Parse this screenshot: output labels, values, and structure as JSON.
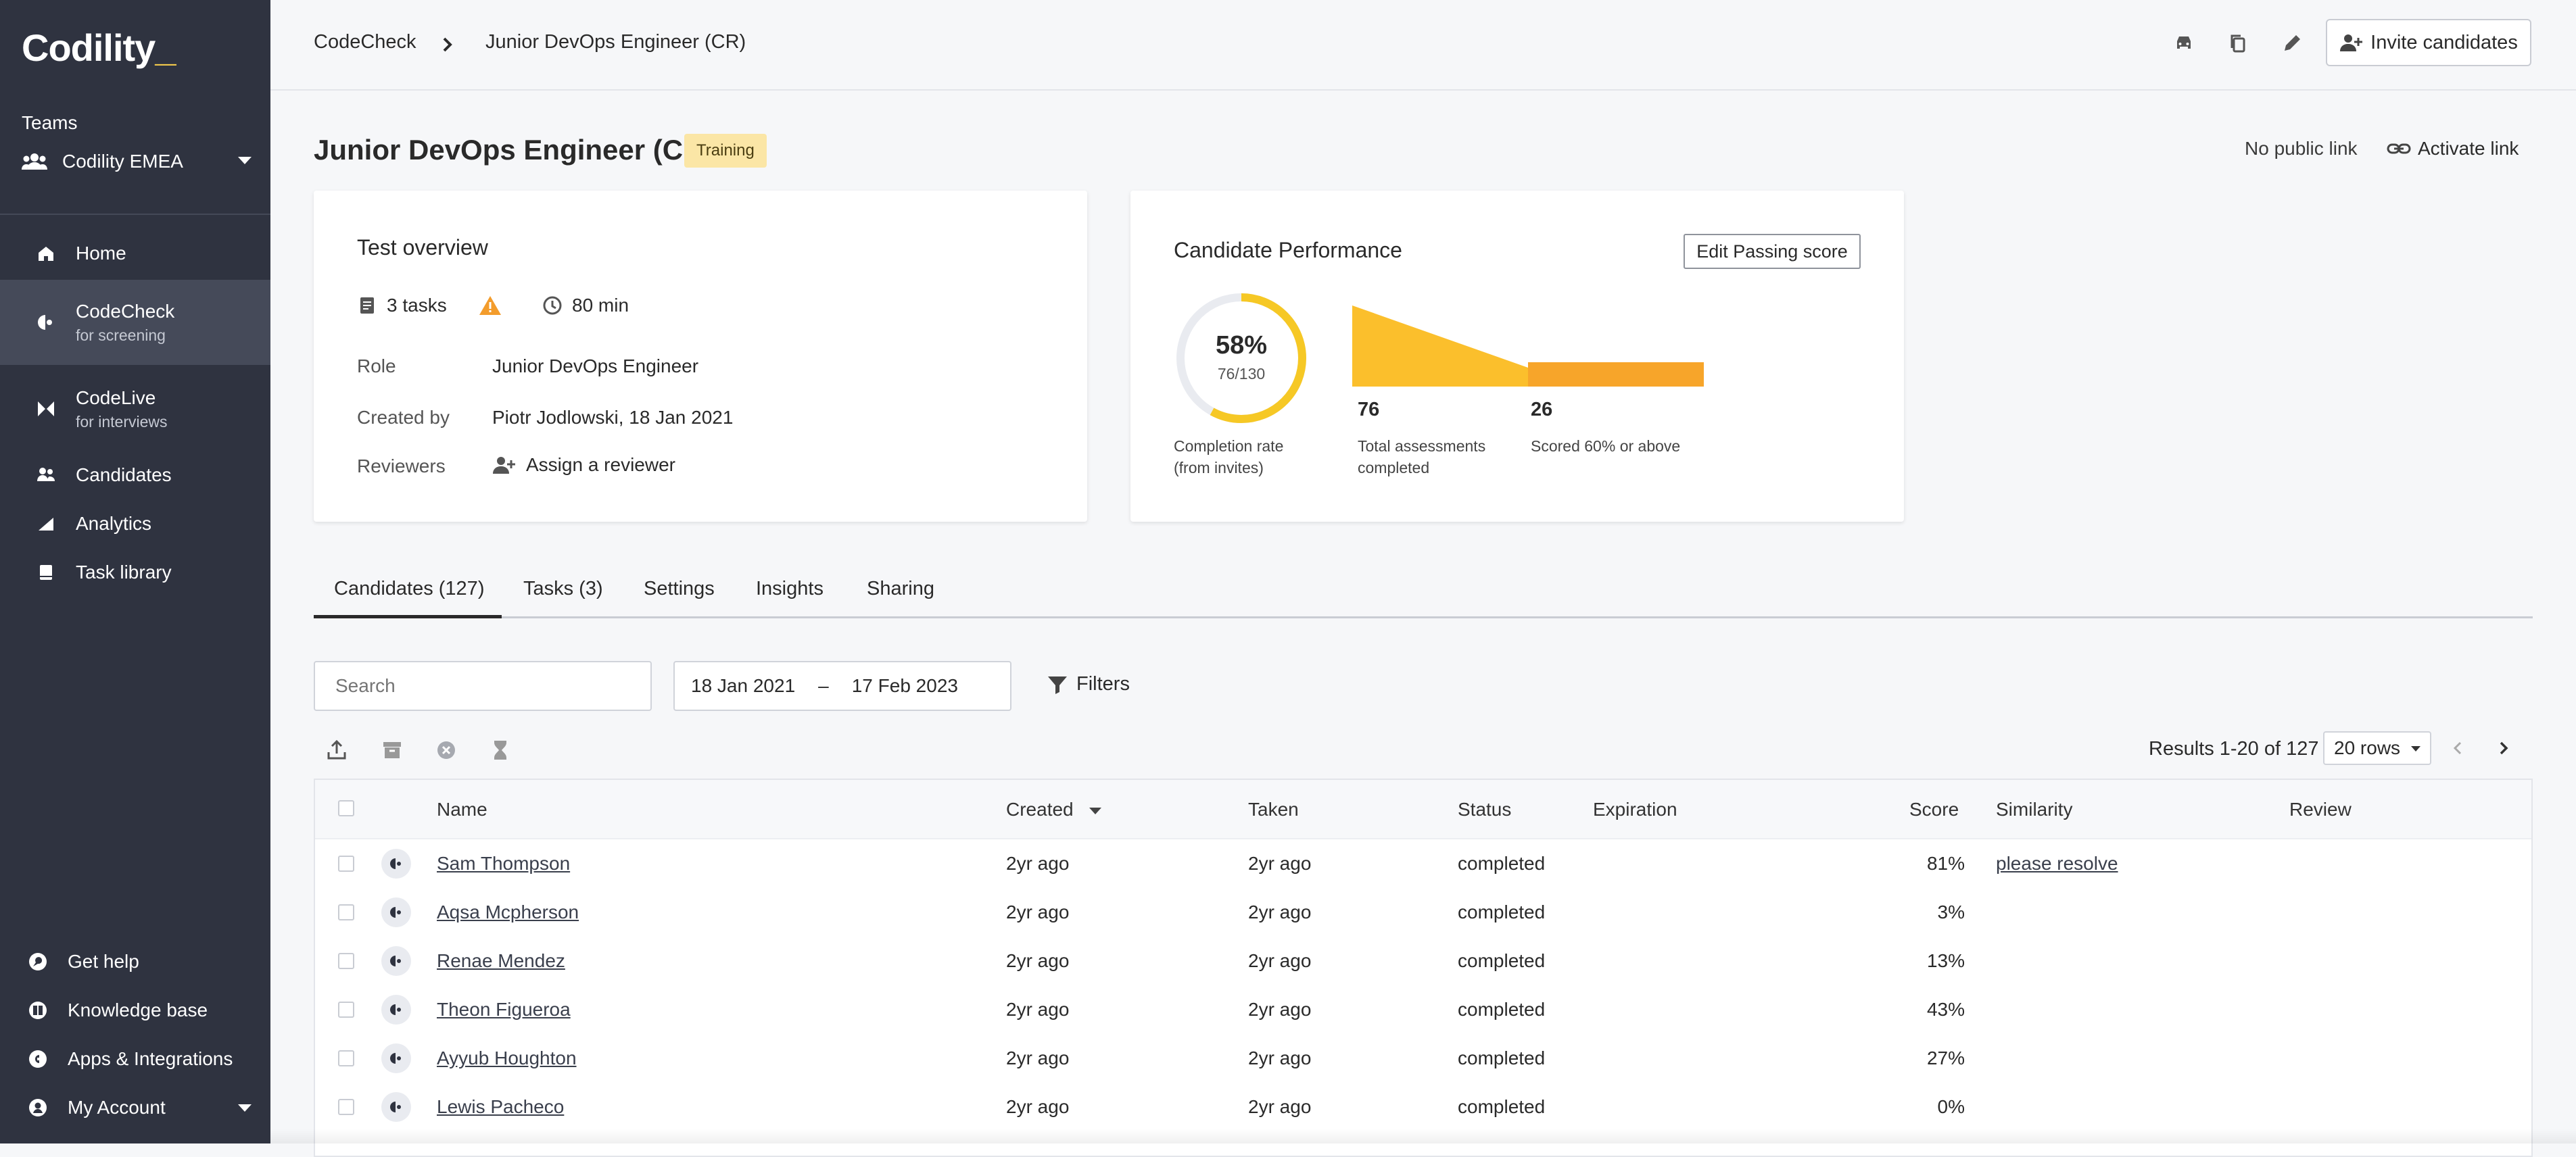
{
  "sidebar": {
    "logo": "Codility",
    "logo_cursor": "_",
    "teams_label": "Teams",
    "team_name": "Codility EMEA",
    "nav": [
      {
        "label": "Home"
      },
      {
        "label": "CodeCheck",
        "sub": "for screening"
      },
      {
        "label": "CodeLive",
        "sub": "for interviews"
      },
      {
        "label": "Candidates"
      },
      {
        "label": "Analytics"
      },
      {
        "label": "Task library"
      }
    ],
    "footer": [
      {
        "label": "Get help"
      },
      {
        "label": "Knowledge base"
      },
      {
        "label": "Apps & Integrations"
      },
      {
        "label": "My Account"
      }
    ]
  },
  "header": {
    "breadcrumb": [
      "CodeCheck",
      "Junior DevOps Engineer (CR)"
    ],
    "invite_label": "Invite candidates"
  },
  "page": {
    "title": "Junior DevOps Engineer (CR)",
    "badge": "Training",
    "public_link_status": "No public link",
    "activate_link": "Activate link"
  },
  "overview": {
    "title": "Test overview",
    "tasks": "3 tasks",
    "duration": "80 min",
    "role_label": "Role",
    "role_value": "Junior DevOps Engineer",
    "created_label": "Created by",
    "created_value": "Piotr Jodlowski, 18 Jan 2021",
    "reviewers_label": "Reviewers",
    "reviewers_value": "Assign a reviewer"
  },
  "performance": {
    "title": "Candidate Performance",
    "edit_button": "Edit Passing score",
    "completion_pct": "58%",
    "completion_frac": "76/130",
    "completion_value": 0.58,
    "completion_label_1": "Completion rate",
    "completion_label_2": "(from invites)",
    "total": "76",
    "total_label_1": "Total assessments",
    "total_label_2": "completed",
    "scored": "26",
    "scored_label": "Scored 60% or above",
    "colors": {
      "ring": "#f6c825",
      "ring_track": "#e9ebf0",
      "funnel": "#fbbf2c",
      "funnel_dark": "#f7a52a"
    }
  },
  "tabs": [
    "Candidates (127)",
    "Tasks (3)",
    "Settings",
    "Insights",
    "Sharing"
  ],
  "filters": {
    "search_placeholder": "Search",
    "date_from": "18 Jan 2021",
    "date_sep": "–",
    "date_to": "17 Feb 2023",
    "filters_label": "Filters"
  },
  "pagination": {
    "results": "Results 1-20 of 127",
    "rows": "20 rows"
  },
  "table": {
    "columns": [
      "Name",
      "Created",
      "Taken",
      "Status",
      "Expiration",
      "Score",
      "Similarity",
      "Review"
    ],
    "rows": [
      {
        "name": "Sam Thompson",
        "created": "2yr ago",
        "taken": "2yr ago",
        "status": "completed",
        "score": "81%",
        "similarity": "please resolve"
      },
      {
        "name": "Aqsa Mcpherson",
        "created": "2yr ago",
        "taken": "2yr ago",
        "status": "completed",
        "score": "3%",
        "similarity": ""
      },
      {
        "name": "Renae Mendez",
        "created": "2yr ago",
        "taken": "2yr ago",
        "status": "completed",
        "score": "13%",
        "similarity": ""
      },
      {
        "name": "Theon Figueroa",
        "created": "2yr ago",
        "taken": "2yr ago",
        "status": "completed",
        "score": "43%",
        "similarity": ""
      },
      {
        "name": "Ayyub Houghton",
        "created": "2yr ago",
        "taken": "2yr ago",
        "status": "completed",
        "score": "27%",
        "similarity": ""
      },
      {
        "name": "Lewis Pacheco",
        "created": "2yr ago",
        "taken": "2yr ago",
        "status": "completed",
        "score": "0%",
        "similarity": ""
      }
    ]
  },
  "colors": {
    "sidebar": "#2f3340",
    "accent": "#f2c94c",
    "badge": "#fbe6a6"
  }
}
